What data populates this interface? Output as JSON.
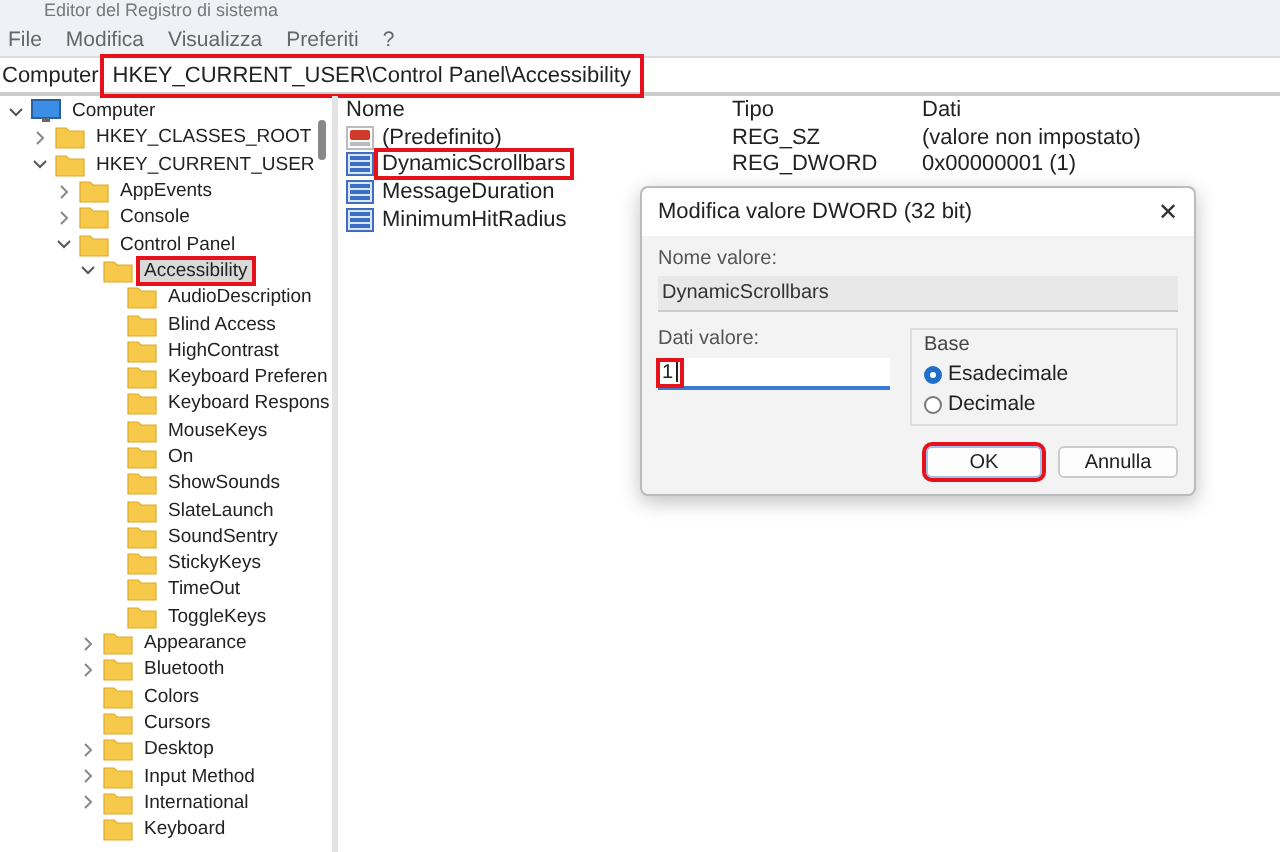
{
  "window": {
    "title": "Editor del Registro di sistema"
  },
  "menu": [
    "File",
    "Modifica",
    "Visualizza",
    "Preferiti",
    "?"
  ],
  "address": {
    "prefix": "Computer",
    "path": "HKEY_CURRENT_USER\\Control Panel\\Accessibility",
    "highlighted": true
  },
  "tree": [
    {
      "label": "Computer",
      "kind": "computer",
      "expanded": true,
      "selected": false,
      "highlighted": false,
      "children": [
        {
          "label": "HKEY_CLASSES_ROOT",
          "kind": "folder",
          "expanded": false,
          "selected": false,
          "highlighted": false
        },
        {
          "label": "HKEY_CURRENT_USER",
          "kind": "folder",
          "expanded": true,
          "selected": false,
          "highlighted": false,
          "children": [
            {
              "label": "AppEvents",
              "kind": "folder",
              "expanded": false,
              "selected": false,
              "highlighted": false
            },
            {
              "label": "Console",
              "kind": "folder",
              "expanded": false,
              "selected": false,
              "highlighted": false
            },
            {
              "label": "Control Panel",
              "kind": "folder",
              "expanded": true,
              "selected": false,
              "highlighted": false,
              "children": [
                {
                  "label": "Accessibility",
                  "kind": "folder",
                  "expanded": true,
                  "selected": true,
                  "highlighted": true,
                  "children": [
                    {
                      "label": "AudioDescription",
                      "kind": "folder",
                      "selected": false,
                      "highlighted": false
                    },
                    {
                      "label": "Blind Access",
                      "kind": "folder",
                      "selected": false,
                      "highlighted": false
                    },
                    {
                      "label": "HighContrast",
                      "kind": "folder",
                      "selected": false,
                      "highlighted": false
                    },
                    {
                      "label": "Keyboard Preferen",
                      "kind": "folder",
                      "selected": false,
                      "highlighted": false
                    },
                    {
                      "label": "Keyboard Respons",
                      "kind": "folder",
                      "selected": false,
                      "highlighted": false
                    },
                    {
                      "label": "MouseKeys",
                      "kind": "folder",
                      "selected": false,
                      "highlighted": false
                    },
                    {
                      "label": "On",
                      "kind": "folder",
                      "selected": false,
                      "highlighted": false
                    },
                    {
                      "label": "ShowSounds",
                      "kind": "folder",
                      "selected": false,
                      "highlighted": false
                    },
                    {
                      "label": "SlateLaunch",
                      "kind": "folder",
                      "selected": false,
                      "highlighted": false
                    },
                    {
                      "label": "SoundSentry",
                      "kind": "folder",
                      "selected": false,
                      "highlighted": false
                    },
                    {
                      "label": "StickyKeys",
                      "kind": "folder",
                      "selected": false,
                      "highlighted": false
                    },
                    {
                      "label": "TimeOut",
                      "kind": "folder",
                      "selected": false,
                      "highlighted": false
                    },
                    {
                      "label": "ToggleKeys",
                      "kind": "folder",
                      "selected": false,
                      "highlighted": false
                    }
                  ]
                },
                {
                  "label": "Appearance",
                  "kind": "folder",
                  "expanded": false,
                  "selected": false,
                  "highlighted": false
                },
                {
                  "label": "Bluetooth",
                  "kind": "folder",
                  "expanded": false,
                  "selected": false,
                  "highlighted": false
                },
                {
                  "label": "Colors",
                  "kind": "folder",
                  "selected": false,
                  "highlighted": false
                },
                {
                  "label": "Cursors",
                  "kind": "folder",
                  "selected": false,
                  "highlighted": false
                },
                {
                  "label": "Desktop",
                  "kind": "folder",
                  "expanded": false,
                  "selected": false,
                  "highlighted": false
                },
                {
                  "label": "Input Method",
                  "kind": "folder",
                  "expanded": false,
                  "selected": false,
                  "highlighted": false
                },
                {
                  "label": "International",
                  "kind": "folder",
                  "expanded": false,
                  "selected": false,
                  "highlighted": false
                },
                {
                  "label": "Keyboard",
                  "kind": "folder",
                  "selected": false,
                  "highlighted": false
                }
              ]
            }
          ]
        }
      ]
    }
  ],
  "values": {
    "columns": [
      "Nome",
      "Tipo",
      "Dati"
    ],
    "rows": [
      {
        "name": "(Predefinito)",
        "type": "REG_SZ",
        "data": "(valore non impostato)",
        "kind": "string",
        "highlighted": false
      },
      {
        "name": "DynamicScrollbars",
        "type": "REG_DWORD",
        "data": "0x00000001 (1)",
        "kind": "binary",
        "highlighted": true
      },
      {
        "name": "MessageDuration",
        "kind": "binary",
        "highlighted": false
      },
      {
        "name": "MinimumHitRadius",
        "kind": "binary",
        "highlighted": false
      }
    ]
  },
  "dialog": {
    "title": "Modifica valore DWORD (32 bit)",
    "close": "✕",
    "name_label": "Nome valore:",
    "name_value": "DynamicScrollbars",
    "data_label": "Dati valore:",
    "data_value": "1",
    "data_highlighted": true,
    "base_label": "Base",
    "base_options": [
      {
        "label": "Esadecimale",
        "selected": true
      },
      {
        "label": "Decimale",
        "selected": false
      }
    ],
    "buttons": [
      {
        "label": "OK",
        "kind": "primary",
        "highlighted": true
      },
      {
        "label": "Annulla",
        "kind": "secondary",
        "highlighted": false
      }
    ]
  }
}
